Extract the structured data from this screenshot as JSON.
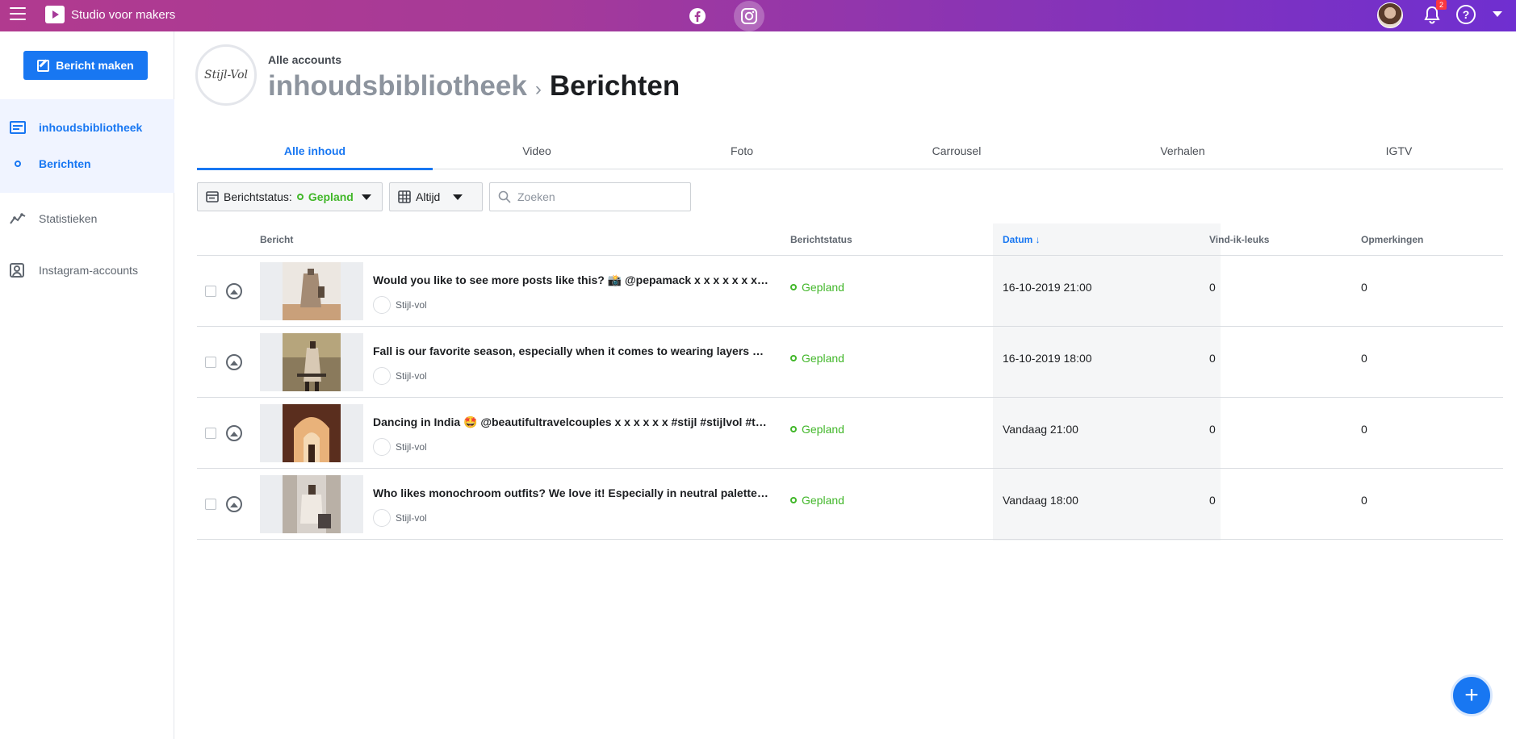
{
  "app": {
    "title": "Studio voor makers",
    "notification_count": "2",
    "help_symbol": "?"
  },
  "sidebar": {
    "create_label": "Bericht maken",
    "items": [
      {
        "label": "inhoudsbibliotheek"
      },
      {
        "label": "Berichten"
      },
      {
        "label": "Statistieken"
      },
      {
        "label": "Instagram-accounts"
      }
    ]
  },
  "header": {
    "account_label": "Alle accounts",
    "account_logo_text": "Stijl-Vol",
    "breadcrumb_parent": "inhoudsbibliotheek",
    "breadcrumb_sep": "›",
    "breadcrumb_current": "Berichten"
  },
  "tabs": [
    {
      "label": "Alle inhoud"
    },
    {
      "label": "Video"
    },
    {
      "label": "Foto"
    },
    {
      "label": "Carrousel"
    },
    {
      "label": "Verhalen"
    },
    {
      "label": "IGTV"
    }
  ],
  "filters": {
    "status_key": "Berichtstatus:",
    "status_value": "Gepland",
    "time_value": "Altijd",
    "search_placeholder": "Zoeken"
  },
  "table": {
    "columns": {
      "post": "Bericht",
      "status": "Berichtstatus",
      "date": "Datum ↓",
      "likes": "Vind-ik-leuks",
      "comments": "Opmerkingen"
    },
    "rows": [
      {
        "title": "Would you like to see more posts like this? 📸 @pepamack x x x x x x x x x x",
        "account": "Stijl-vol",
        "status": "Gepland",
        "date": "16-10-2019 21:00",
        "likes": "0",
        "comments": "0"
      },
      {
        "title": "Fall is our favorite season, especially when it comes to wearing layers and coats",
        "account": "Stijl-vol",
        "status": "Gepland",
        "date": "16-10-2019 18:00",
        "likes": "0",
        "comments": "0"
      },
      {
        "title": "Dancing in India 🤩 @beautifultravelcouples x x x x x x #stijl #stijlvol #travel",
        "account": "Stijl-vol",
        "status": "Gepland",
        "date": "Vandaag 21:00",
        "likes": "0",
        "comments": "0"
      },
      {
        "title": "Who likes monochroom outfits? We love it! Especially in neutral palettes and tones",
        "account": "Stijl-vol",
        "status": "Gepland",
        "date": "Vandaag 18:00",
        "likes": "0",
        "comments": "0"
      }
    ]
  },
  "fab_symbol": "+",
  "colors": {
    "accent": "#1877f2",
    "scheduled": "#42b72a",
    "topbar_start": "#b13a8f",
    "topbar_end": "#6f2fd0"
  }
}
